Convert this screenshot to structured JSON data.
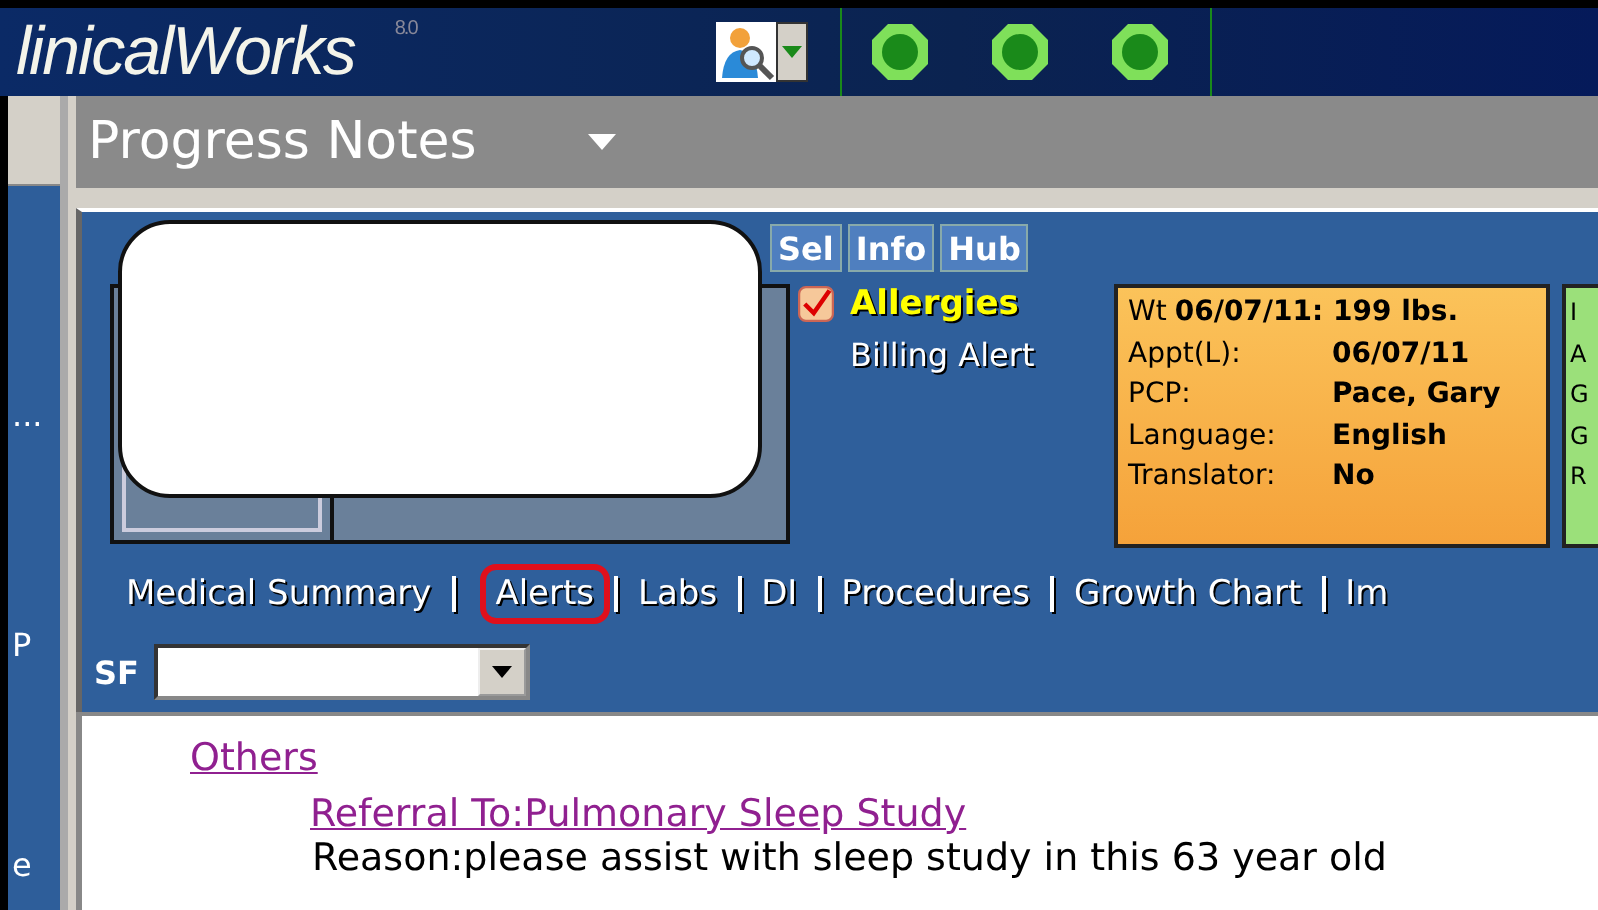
{
  "header": {
    "logo": "linicalWorks",
    "version": "8.0",
    "status_lights": [
      {
        "color": "#1a8a1a"
      },
      {
        "color": "#1a8a1a"
      },
      {
        "color": "#1a8a1a"
      }
    ]
  },
  "sidebar": {
    "items": [
      "...",
      "P",
      "e"
    ]
  },
  "window": {
    "title": "Progress Notes"
  },
  "patient_tabs": [
    {
      "label": "Sel",
      "selected": false
    },
    {
      "label": "Info",
      "selected": false
    },
    {
      "label": "Hub",
      "selected": false
    }
  ],
  "alerts": {
    "allergies": "Allergies",
    "billing": "Billing Alert"
  },
  "info_card": {
    "rows": [
      {
        "label": "Wt",
        "value": "06/07/11: 199 lbs."
      },
      {
        "label": "Appt(L):",
        "value": "06/07/11"
      },
      {
        "label": "PCP:",
        "value": "Pace, Gary"
      },
      {
        "label": "Language:",
        "value": "English"
      },
      {
        "label": "Translator:",
        "value": "No"
      }
    ]
  },
  "side_card": {
    "lines": [
      "I",
      "A",
      "G",
      "G",
      "R"
    ]
  },
  "nav_links": [
    {
      "label": "Medical Summary",
      "highlighted": false
    },
    {
      "label": "Alerts",
      "highlighted": true
    },
    {
      "label": "Labs",
      "highlighted": false
    },
    {
      "label": "DI",
      "highlighted": false
    },
    {
      "label": "Procedures",
      "highlighted": false
    },
    {
      "label": "Growth Chart",
      "highlighted": false
    },
    {
      "label": "Im",
      "highlighted": false
    }
  ],
  "sf": {
    "label": "SF"
  },
  "content": [
    {
      "kind": "heading",
      "text": "Others"
    },
    {
      "kind": "link",
      "text": "Referral To:Pulmonary Sleep Study"
    },
    {
      "kind": "text",
      "text": "Reason:please assist with sleep study in this 63 year old"
    }
  ]
}
